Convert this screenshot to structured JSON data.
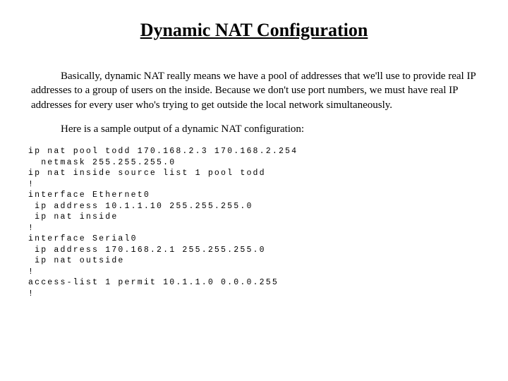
{
  "title": "Dynamic NAT Configuration",
  "para1": "Basically, dynamic NAT really means we have a pool of addresses that we'll use to provide real IP addresses to a group of users on the inside. Because we don't use port numbers, we must have real IP addresses for every user who's trying to get outside the local network simultaneously.",
  "para2": "Here is a sample output of a dynamic NAT configuration:",
  "code": "ip nat pool todd 170.168.2.3 170.168.2.254\n  netmask 255.255.255.0\nip nat inside source list 1 pool todd\n!\ninterface Ethernet0\n ip address 10.1.1.10 255.255.255.0\n ip nat inside\n!\ninterface Serial0\n ip address 170.168.2.1 255.255.255.0\n ip nat outside\n!\naccess-list 1 permit 10.1.1.0 0.0.0.255\n!"
}
